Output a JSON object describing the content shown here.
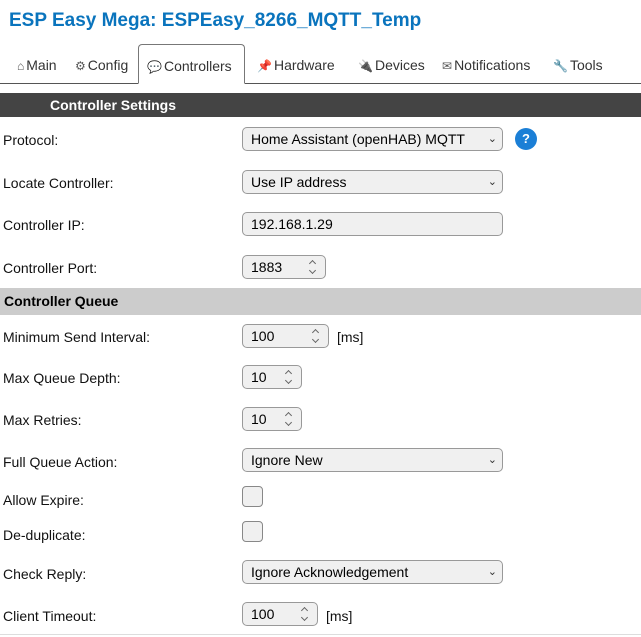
{
  "title": "ESP Easy Mega: ESPEasy_8266_MQTT_Temp",
  "tabs": [
    {
      "label": "Main",
      "icon": "home-icon"
    },
    {
      "label": "Config",
      "icon": "gear-icon"
    },
    {
      "label": "Controllers",
      "icon": "speech-bubble-icon"
    },
    {
      "label": "Hardware",
      "icon": "pushpin-icon"
    },
    {
      "label": "Devices",
      "icon": "plug-icon"
    },
    {
      "label": "Notifications",
      "icon": "envelope-icon"
    },
    {
      "label": "Tools",
      "icon": "wrench-icon"
    }
  ],
  "active_tab": "Controllers",
  "sections": {
    "settings": "Controller Settings",
    "queue": "Controller Queue"
  },
  "help_label": "?",
  "fields": {
    "protocol": {
      "label": "Protocol:",
      "value": "Home Assistant (openHAB) MQTT"
    },
    "locate": {
      "label": "Locate Controller:",
      "value": "Use IP address"
    },
    "ip": {
      "label": "Controller IP:",
      "value": "192.168.1.29"
    },
    "port": {
      "label": "Controller Port:",
      "value": "1883"
    },
    "min_interval": {
      "label": "Minimum Send Interval:",
      "value": "100",
      "unit": "[ms]"
    },
    "queue_depth": {
      "label": "Max Queue Depth:",
      "value": "10"
    },
    "retries": {
      "label": "Max Retries:",
      "value": "10"
    },
    "full_action": {
      "label": "Full Queue Action:",
      "value": "Ignore New"
    },
    "allow_expire": {
      "label": "Allow Expire:",
      "checked": false
    },
    "dedup": {
      "label": "De-duplicate:",
      "checked": false
    },
    "check_reply": {
      "label": "Check Reply:",
      "value": "Ignore Acknowledgement"
    },
    "timeout": {
      "label": "Client Timeout:",
      "value": "100",
      "unit": "[ms]"
    }
  },
  "colors": {
    "title": "#0a74bd",
    "section_dark": "#444444",
    "section_light": "#cccccc",
    "help": "#1b7fd6"
  }
}
